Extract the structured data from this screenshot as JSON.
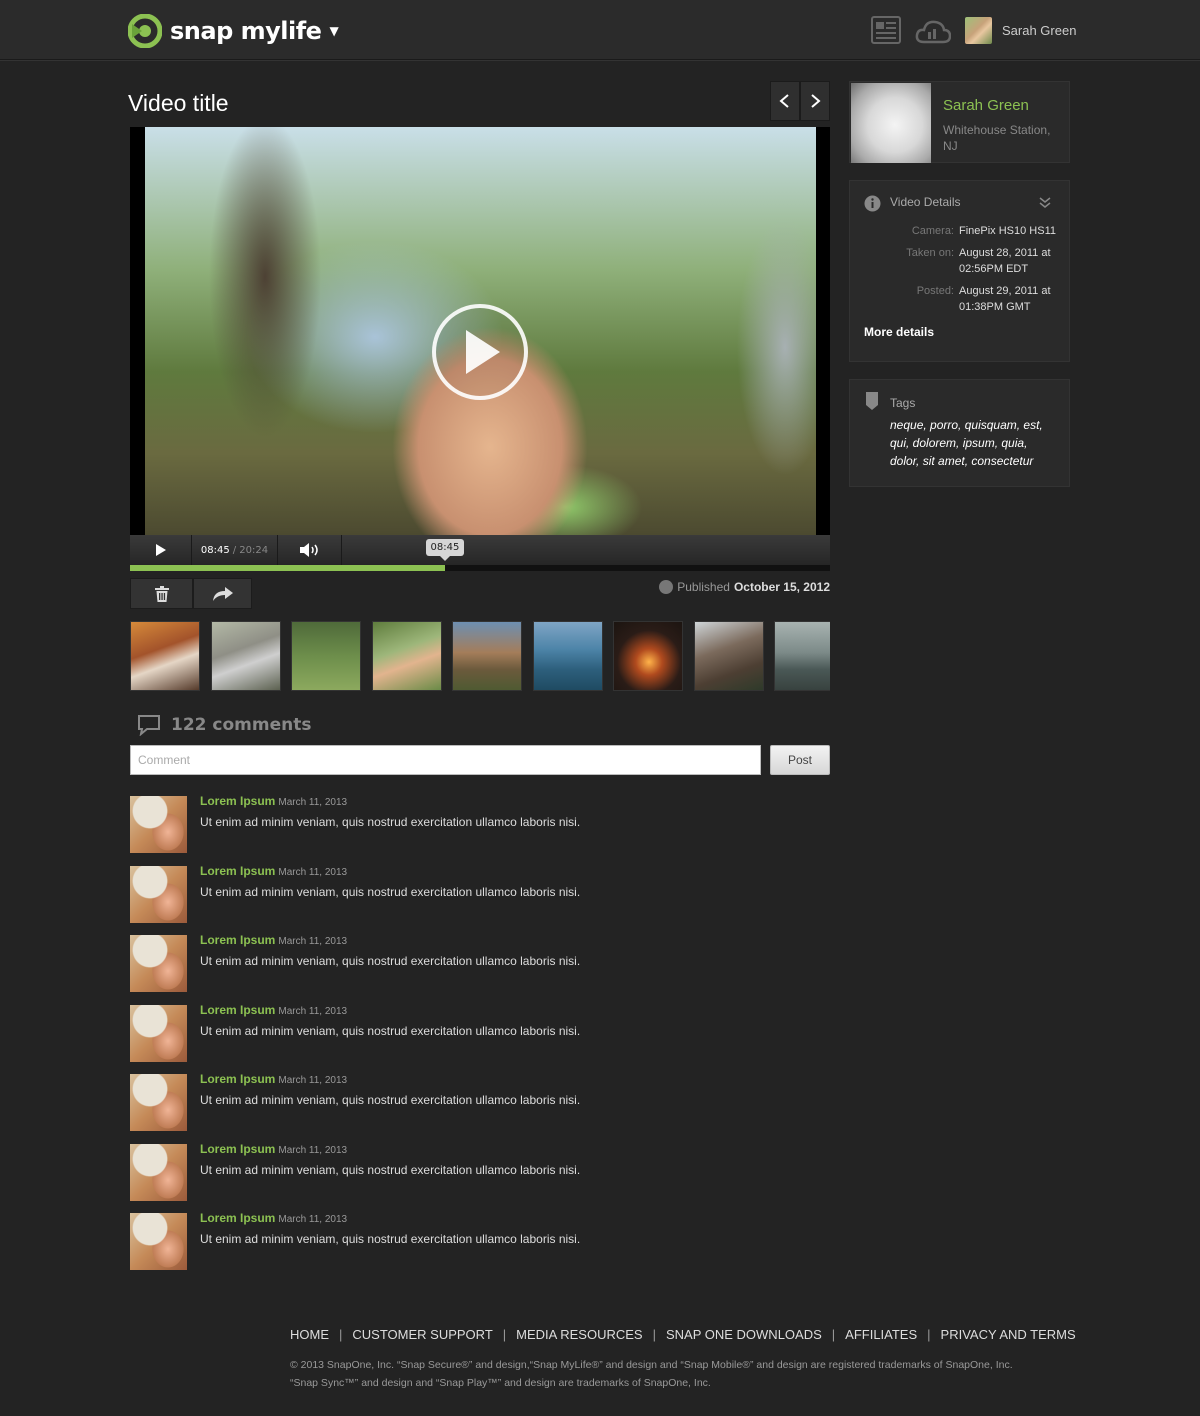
{
  "header": {
    "logo_text": "snap mylife",
    "user_name": "Sarah Green"
  },
  "video": {
    "title": "Video title",
    "current_time": "08:45",
    "duration": "/ 20:24",
    "tooltip_time": "08:45",
    "progress_fraction": 0.45,
    "published_label": "Published",
    "published_date": "October 15, 2012"
  },
  "comments": {
    "count_label": "122 comments",
    "input_placeholder": "Comment",
    "post_label": "Post",
    "items": [
      {
        "author": "Lorem Ipsum",
        "date": "March 11, 2013",
        "text": "Ut enim ad minim veniam, quis nostrud exercitation ullamco laboris nisi."
      },
      {
        "author": "Lorem Ipsum",
        "date": "March 11, 2013",
        "text": "Ut enim ad minim veniam, quis nostrud exercitation ullamco laboris nisi."
      },
      {
        "author": "Lorem Ipsum",
        "date": "March 11, 2013",
        "text": "Ut enim ad minim veniam, quis nostrud exercitation ullamco laboris nisi."
      },
      {
        "author": "Lorem Ipsum",
        "date": "March 11, 2013",
        "text": "Ut enim ad minim veniam, quis nostrud exercitation ullamco laboris nisi."
      },
      {
        "author": "Lorem Ipsum",
        "date": "March 11, 2013",
        "text": "Ut enim ad minim veniam, quis nostrud exercitation ullamco laboris nisi."
      },
      {
        "author": "Lorem Ipsum",
        "date": "March 11, 2013",
        "text": "Ut enim ad minim veniam, quis nostrud exercitation ullamco laboris nisi."
      },
      {
        "author": "Lorem Ipsum",
        "date": "March 11, 2013",
        "text": "Ut enim ad minim veniam, quis nostrud exercitation ullamco laboris nisi."
      }
    ]
  },
  "profile": {
    "name": "Sarah Green",
    "location": "Whitehouse Station, NJ"
  },
  "video_details": {
    "title": "Video Details",
    "rows": [
      {
        "key": "Camera:",
        "value": "FinePix HS10 HS11"
      },
      {
        "key": "Taken on:",
        "value": "August 28, 2011 at 02:56PM EDT"
      },
      {
        "key": "Posted:",
        "value": "August 29, 2011 at 01:38PM GMT"
      }
    ],
    "more_label": "More details"
  },
  "tags": {
    "title": "Tags",
    "text": "neque, porro, quisquam, est, qui, dolorem, ipsum, quia, dolor, sit amet, consectetur"
  },
  "footer": {
    "links": [
      "HOME",
      "CUSTOMER SUPPORT",
      "MEDIA RESOURCES",
      "SNAP ONE DOWNLOADS",
      "AFFILIATES",
      "PRIVACY AND TERMS"
    ],
    "copyright_line1": "© 2013 SnapOne, Inc. “Snap Secure®” and design,“Snap MyLife®” and design and “Snap Mobile®” and design are registered trademarks of SnapOne, Inc.",
    "copyright_line2": "“Snap Sync™” and design and “Snap Play™” and design are trademarks of SnapOne, Inc."
  },
  "colors": {
    "accent": "#8cc152",
    "background": "#232323",
    "header": "#2b2b2b"
  },
  "icons": [
    "logo-icon",
    "chevron-down-icon",
    "news-icon",
    "cloud-icon",
    "chevron-left-icon",
    "chevron-right-icon",
    "play-icon",
    "volume-icon",
    "trash-icon",
    "share-icon",
    "globe-icon",
    "comment-bubble-icon",
    "info-icon",
    "double-chevron-down-icon",
    "tag-icon"
  ]
}
